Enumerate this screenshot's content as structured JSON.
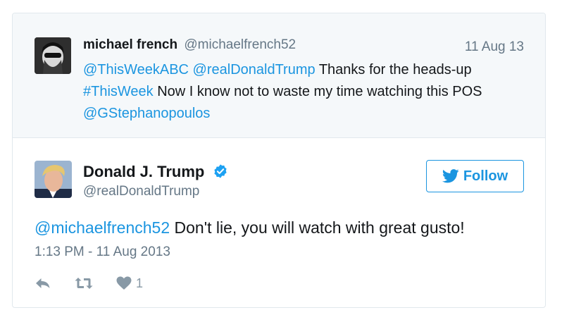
{
  "parent_tweet": {
    "author_name": "michael french",
    "author_handle": "@michaelfrench52",
    "date": "11 Aug 13",
    "mention_1": "@ThisWeekABC",
    "mention_2": "@realDonaldTrump",
    "text_1": " Thanks for the heads-up",
    "hashtag": "#ThisWeek",
    "text_2": " Now I know not to waste my time watching this POS",
    "mention_3": "@GStephanopoulos"
  },
  "main_tweet": {
    "author_name": "Donald J. Trump",
    "author_handle": "@realDonaldTrump",
    "follow_label": "Follow",
    "reply_mention": "@michaelfrench52",
    "text": " Don't lie, you will watch with great gusto!",
    "timestamp": "1:13 PM - 11 Aug 2013",
    "like_count": "1"
  },
  "colors": {
    "link": "#1b95e0",
    "secondary_text": "#657786",
    "icon": "#8899a6",
    "parent_bg": "#f5f8fa"
  },
  "icons": [
    "verified-badge-icon",
    "twitter-bird-icon",
    "reply-icon",
    "retweet-icon",
    "heart-icon"
  ]
}
